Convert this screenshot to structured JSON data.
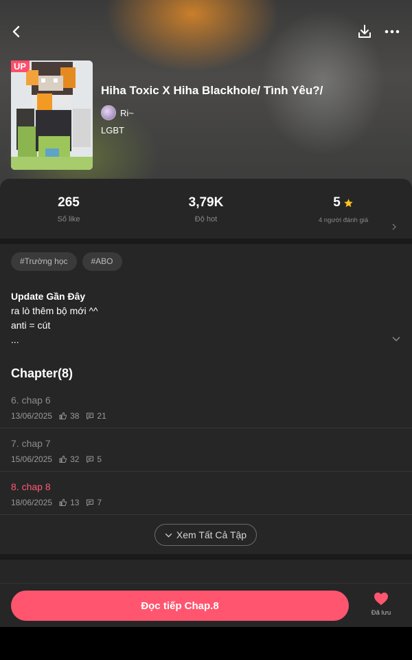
{
  "header": {
    "badge": "UP",
    "title": "Hiha Toxic X Hiha Blackhole/ Tình Yêu?/",
    "author": "Ri~",
    "genre": "LGBT"
  },
  "stats": [
    {
      "value": "265",
      "label": "Số like"
    },
    {
      "value": "3,79K",
      "label": "Độ hot"
    },
    {
      "value": "5",
      "label": "4 người đánh giá"
    }
  ],
  "tags": [
    "#Trường học",
    "#ABO"
  ],
  "update": {
    "title": "Update Gần Đây",
    "lines": [
      "ra lò thêm bộ mới ^^",
      "anti = cút",
      "..."
    ]
  },
  "chapters_heading": "Chapter(8)",
  "chapters": [
    {
      "title": "6. chap 6",
      "date": "13/06/2025",
      "likes": "38",
      "comments": "21",
      "active": false
    },
    {
      "title": "7. chap 7",
      "date": "15/06/2025",
      "likes": "32",
      "comments": "5",
      "active": false
    },
    {
      "title": "8. chap 8",
      "date": "18/06/2025",
      "likes": "13",
      "comments": "7",
      "active": true
    }
  ],
  "see_all_label": "Xem Tất Cả Tập",
  "bottom": {
    "read_label": "Đọc tiếp Chap.8",
    "save_label": "Đã lưu"
  },
  "colors": {
    "accent": "#ff556f",
    "panel": "#262626",
    "star": "#ffc21a"
  },
  "icons": [
    "back-icon",
    "download-icon",
    "more-icon",
    "star-icon",
    "chevron-right-icon",
    "chevron-down-icon",
    "thumb-up-icon",
    "comment-icon",
    "heart-icon"
  ]
}
